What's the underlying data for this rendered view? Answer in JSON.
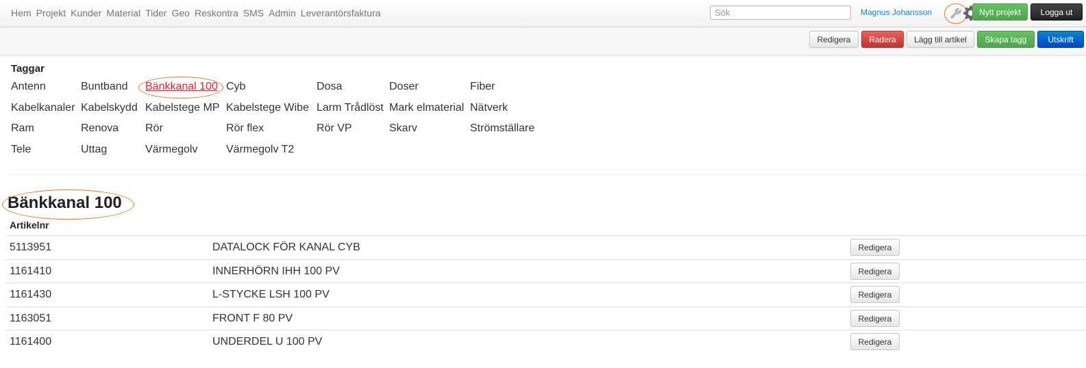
{
  "nav": {
    "items": [
      "Hem",
      "Projekt",
      "Kunder",
      "Material",
      "Tider",
      "Geo",
      "Reskontra",
      "SMS",
      "Admin",
      "Leverantörsfaktura"
    ]
  },
  "header": {
    "search_placeholder": "Sök",
    "user_name": "Magnus Johansson",
    "new_project_label": "Nytt projekt",
    "logout_label": "Logga ut"
  },
  "toolbar": {
    "edit_label": "Redigera",
    "delete_label": "Radera",
    "add_article_label": "Lägg till artikel",
    "create_tag_label": "Skapa tagg",
    "print_label": "Utskrift"
  },
  "tags": {
    "title": "Taggar",
    "items": [
      "Antenn",
      "Buntband",
      "Bänkkanal 100",
      "Cyb",
      "Dosa",
      "Doser",
      "Fiber",
      "Kabelkanaler",
      "Kabelskydd",
      "Kabelstege MP",
      "Kabelstege Wibe",
      "Larm Trådlöst",
      "Mark elmaterial",
      "Nätverk",
      "Ram",
      "Renova",
      "Rör",
      "Rör flex",
      "Rör VP",
      "Skarv",
      "Strömställare",
      "Tele",
      "Uttag",
      "Värmegolv",
      "Värmegolv T2"
    ],
    "active": "Bänkkanal 100"
  },
  "main": {
    "heading": "Bänkkanal 100",
    "column_header": "Artikelnr",
    "row_edit_label": "Redigera",
    "rows": [
      {
        "number": "5113951",
        "description": "DATALOCK FÖR KANAL CYB"
      },
      {
        "number": "1161410",
        "description": "INNERHÖRN IHH 100 PV"
      },
      {
        "number": "1161430",
        "description": "L-STYCKE LSH 100 PV"
      },
      {
        "number": "1163051",
        "description": "FRONT F 80 PV"
      },
      {
        "number": "1161400",
        "description": "UNDERDEL U 100 PV"
      }
    ]
  }
}
